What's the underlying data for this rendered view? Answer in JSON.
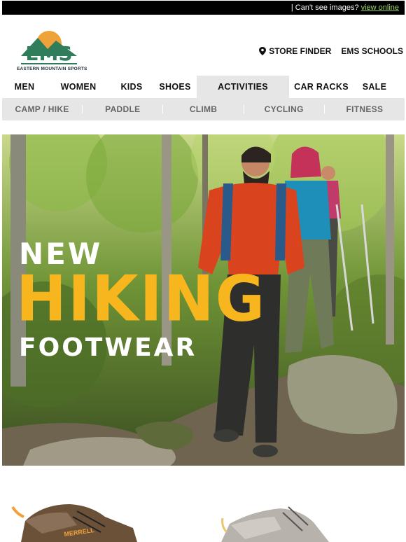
{
  "topbar": {
    "text": "| Can't see images?",
    "link": "view online"
  },
  "brand": {
    "logo_text": "EMS",
    "tagline": "EASTERN MOUNTAIN SPORTS"
  },
  "header_links": {
    "store_finder": "STORE FINDER",
    "schools": "EMS SCHOOLS"
  },
  "main_nav": [
    "MEN",
    "WOMEN",
    "KIDS",
    "SHOES",
    "ACTIVITIES",
    "CAR RACKS",
    "SALE"
  ],
  "active_nav": "ACTIVITIES",
  "sub_nav": [
    "CAMP / HIKE",
    "PADDLE",
    "CLIMB",
    "CYCLING",
    "FITNESS"
  ],
  "hero": {
    "line1": "NEW",
    "line2": "HIKING",
    "line3": "FOOTWEAR"
  },
  "colors": {
    "hero_accent": "#f8b61e",
    "logo_green": "#2f7d5a",
    "logo_orange": "#f0a23a",
    "nav_active_bg": "#e6e6e6"
  },
  "products": [
    {
      "icon": "brown-hiking-shoe-image",
      "brand_mark": "MERRELL"
    },
    {
      "icon": "grey-hiking-shoe-image"
    }
  ]
}
